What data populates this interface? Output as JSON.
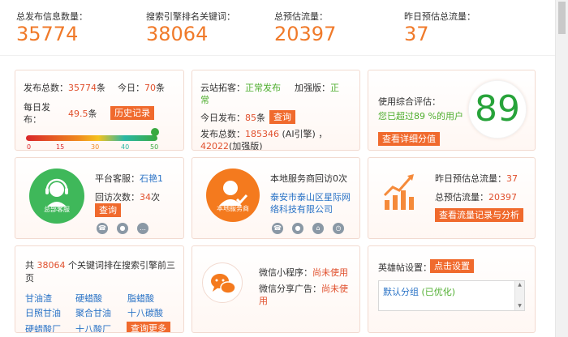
{
  "top_stats": [
    {
      "label": "总发布信息数量：",
      "value": "35774"
    },
    {
      "label": "搜索引擎排名关键词：",
      "value": "38064"
    },
    {
      "label": "总预估流量：",
      "value": "20397"
    },
    {
      "label": "昨日预估总流量：",
      "value": "37"
    }
  ],
  "publish_card": {
    "total_label": "发布总数：",
    "total_value": "35774",
    "unit": "条",
    "today_label": "今日：",
    "today_value": "70",
    "today_unit": "条",
    "daily_label_1": "每日发",
    "daily_label_2": "布：",
    "daily_value": "49.5",
    "daily_unit": "条",
    "history_button": "历史记录",
    "gauge_ticks": [
      "0",
      "15",
      "30",
      "40",
      "50"
    ]
  },
  "cloud_card": {
    "expand_label": "云站拓客：",
    "expand_value": "正常发布",
    "enhanced_label": "加强版：",
    "enhanced_value_1": "正",
    "enhanced_value_2": "常",
    "today_label": "今日发布：",
    "today_value": "85",
    "today_unit": "条",
    "query_button": "查询",
    "total_label": "发布总数：",
    "total_value": "185346",
    "total_note": "(AI引擎)",
    "total_value_2": "42022",
    "total_note_2": "(加强版)"
  },
  "score_card": {
    "label": "使用综合评估：",
    "beat_text_1": "您已超过",
    "beat_value": "89",
    "beat_text_2": "%的用户",
    "score": "89",
    "detail_button": "查看详细分值"
  },
  "support_card": {
    "icon_caption": "总部客服",
    "service_label": "平台客服：",
    "service_value": "石艳1",
    "visits_label": "回访次数：",
    "visits_value": "34",
    "visits_unit": "次",
    "query_button": "查询"
  },
  "local_card": {
    "icon_caption": "本地服务商",
    "visits_text": "本地服务商回访0次",
    "company_1": "泰安市泰山区星际网",
    "company_2": "络科技有限公司"
  },
  "traffic_card": {
    "yesterday_label": "昨日预估总流量：",
    "yesterday_value": "37",
    "total_label": "总预估流量：",
    "total_value": "20397",
    "detail_button": "查看流量记录与分析"
  },
  "keyword_card": {
    "prefix": "共",
    "count": "38064",
    "suffix_1": "个关键词排在搜索引擎前三",
    "suffix_2": "页",
    "keywords": [
      "甘油渣",
      "硬蜡酸",
      "脂蜡酸",
      "日照甘油",
      "聚合甘油",
      "十八碳酸",
      "硬蜡酸厂",
      "十八酸厂"
    ],
    "more_button": "查询更多"
  },
  "wechat_card": {
    "mini_label": "微信小程序：",
    "mini_value": "尚未使用",
    "share_label": "微信分享广告：",
    "share_value_1": "尚未使",
    "share_value_2": "用"
  },
  "post_card": {
    "label": "英雄帖设置：",
    "set_button": "点击设置",
    "group_name": "默认分组",
    "group_status": "(已优化)"
  },
  "colors": {
    "accent": "#f06a2d",
    "number_orange": "#f07a2a",
    "green": "#4fae2f",
    "blue": "#2a73c6",
    "support_green": "#3fb85a",
    "local_orange": "#f47a1e"
  }
}
